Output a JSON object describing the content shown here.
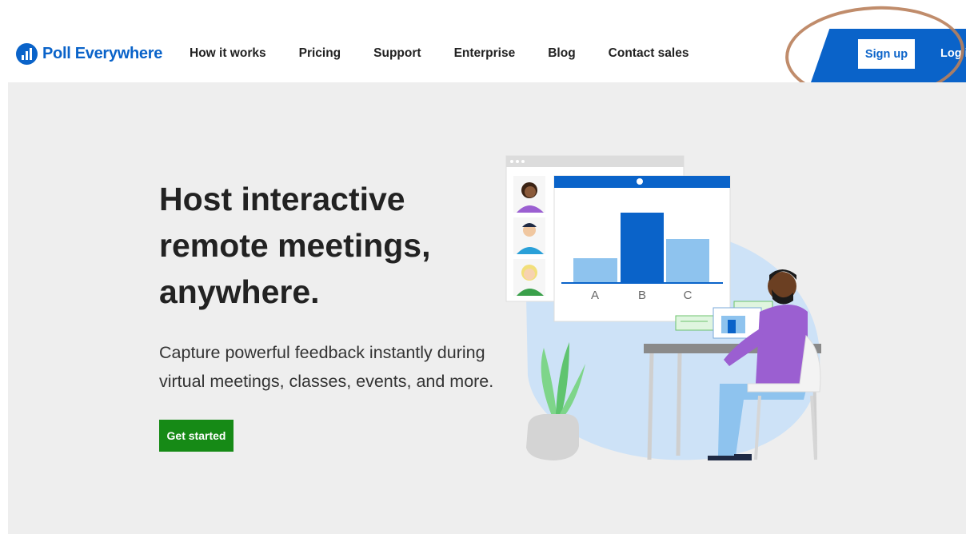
{
  "header": {
    "brand": "Poll Everywhere",
    "nav": [
      {
        "label": "How it works"
      },
      {
        "label": "Pricing"
      },
      {
        "label": "Support"
      },
      {
        "label": "Enterprise"
      },
      {
        "label": "Blog"
      },
      {
        "label": "Contact sales"
      }
    ],
    "signup_label": "Sign up",
    "login_label": "Log in"
  },
  "hero": {
    "headline": "Host interactive remote meetings, anywhere.",
    "subtext": "Capture powerful feedback instantly during virtual meetings, classes, events, and more.",
    "cta_label": "Get started"
  },
  "illustration": {
    "poll_options": [
      "A",
      "B",
      "C"
    ]
  },
  "colors": {
    "brand_blue": "#0a63c9",
    "cta_green": "#168a16",
    "hero_bg": "#eeeeee",
    "annotation": "#b97f5b"
  }
}
